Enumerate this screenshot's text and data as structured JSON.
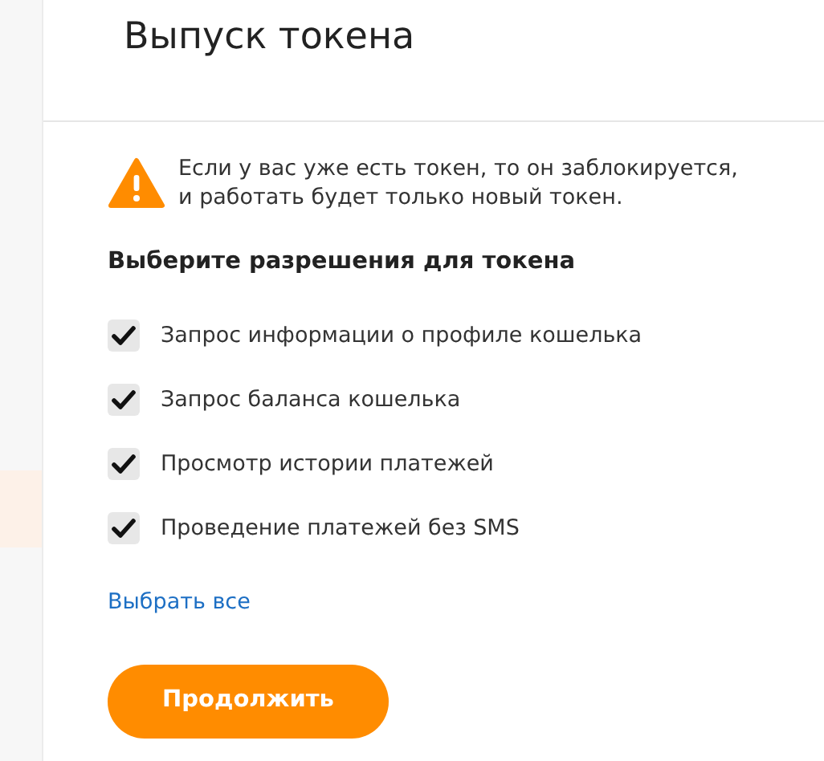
{
  "modal": {
    "title": "Выпуск токена",
    "warning": "Если у вас уже есть токен, то он заблокируется,\nи работать будет только новый токен.",
    "permissions_heading": "Выберите разрешения для токена",
    "permissions": [
      {
        "label": "Запрос информации о профиле кошелька",
        "checked": true
      },
      {
        "label": "Запрос баланса кошелька",
        "checked": true
      },
      {
        "label": "Просмотр истории платежей",
        "checked": true
      },
      {
        "label": "Проведение платежей без SMS",
        "checked": true
      }
    ],
    "select_all": "Выбрать все",
    "button": "Продолжить"
  }
}
